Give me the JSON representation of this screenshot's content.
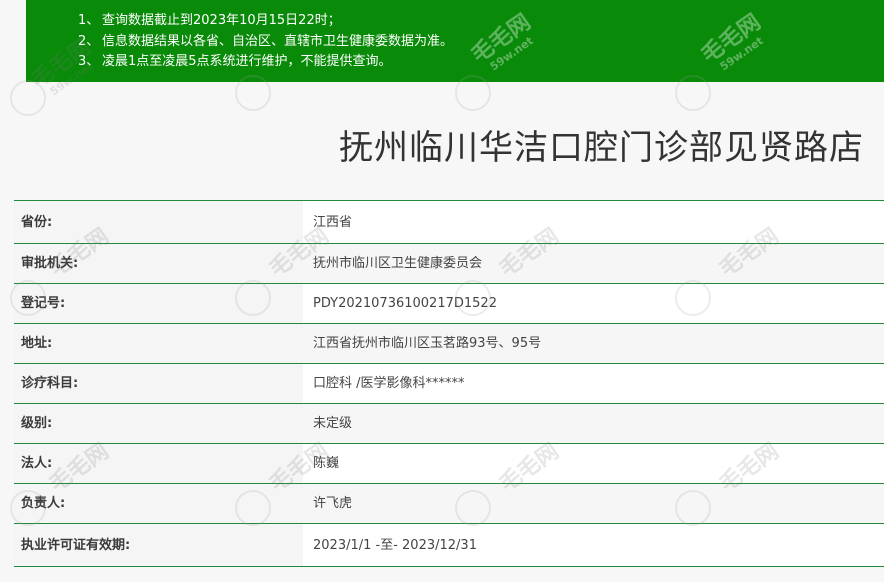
{
  "notice": {
    "items": [
      {
        "num": "1、",
        "text": "查询数据截止到2023年10月15日22时；"
      },
      {
        "num": "2、",
        "text": "信息数据结果以各省、自治区、直辖市卫生健康委数据为准。"
      },
      {
        "num": "3、",
        "text": "凌晨1点至凌晨5点系统进行维护，不能提供查询。"
      }
    ]
  },
  "title": "抚州临川华洁口腔门诊部见贤路店",
  "info": [
    {
      "label": "省份:",
      "value": "江西省"
    },
    {
      "label": "审批机关:",
      "value": "抚州市临川区卫生健康委员会"
    },
    {
      "label": "登记号:",
      "value": "PDY20210736100217D1522"
    },
    {
      "label": "地址:",
      "value": "江西省抚州市临川区玉茗路93号、95号"
    },
    {
      "label": "诊疗科目:",
      "value": "口腔科 /医学影像科******"
    },
    {
      "label": "级别:",
      "value": "未定级"
    },
    {
      "label": "法人:",
      "value": "陈巍"
    },
    {
      "label": "负责人:",
      "value": "许飞虎"
    },
    {
      "label": "执业许可证有效期:",
      "value": "2023/1/1 -至- 2023/12/31"
    }
  ],
  "watermark": {
    "main": "毛毛网",
    "sub": "59w.net"
  },
  "colors": {
    "notice_bg": "#098b09",
    "row_border": "#1d8a3c"
  }
}
